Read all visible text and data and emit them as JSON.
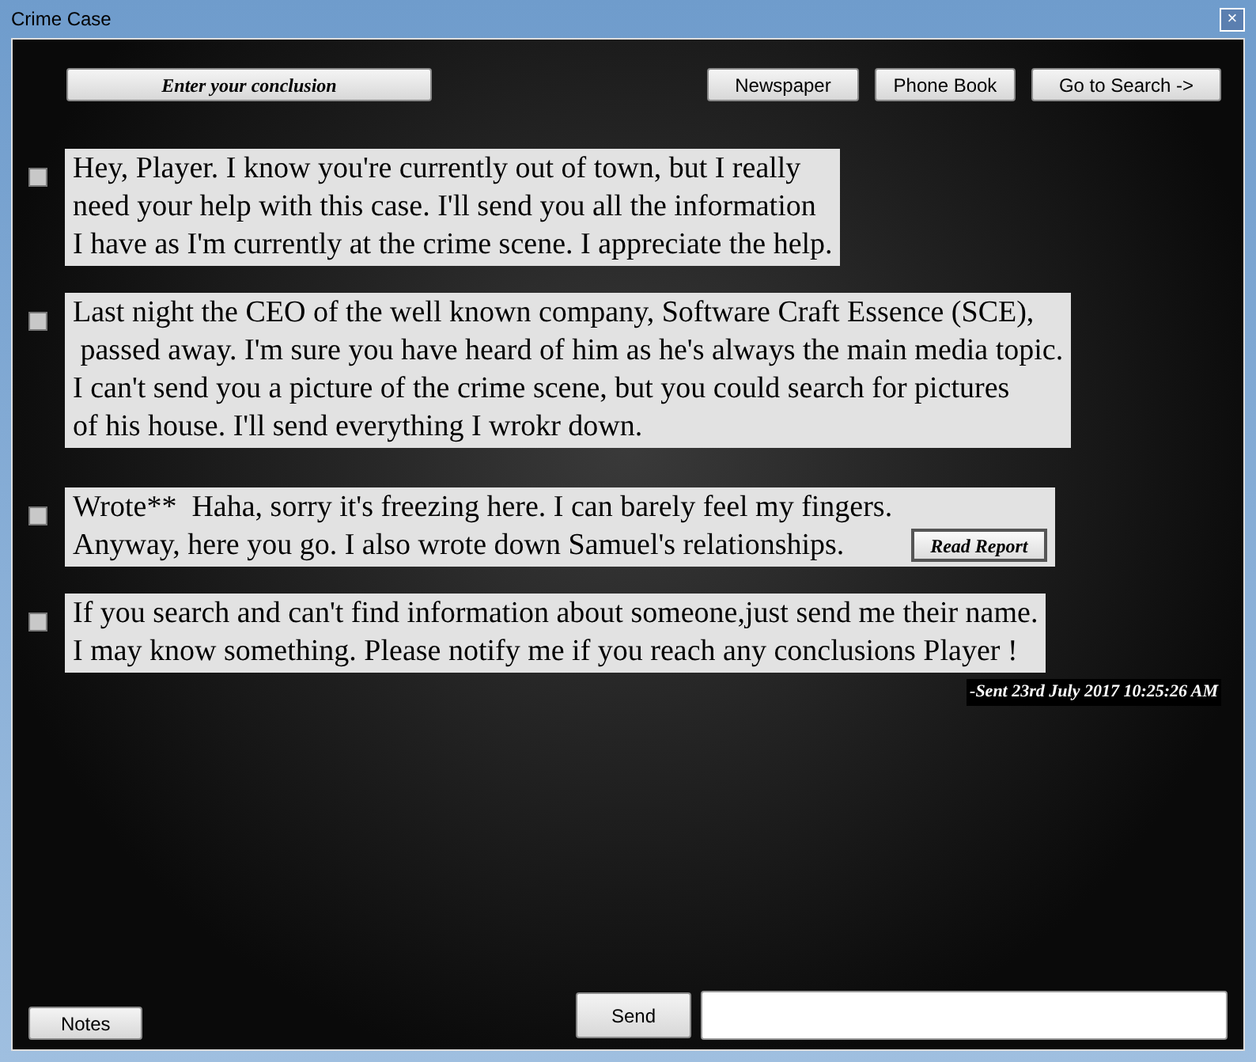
{
  "window": {
    "title": "Crime Case",
    "close": "×"
  },
  "top_buttons": {
    "conclusion": "Enter your conclusion",
    "actions": [
      "Newspaper",
      "Phone Book",
      "Go to Search ->"
    ]
  },
  "messages": [
    {
      "checked": false,
      "lines": [
        "Hey, Player. I know you're currently out of town, but I really",
        "need your help with this case. I'll send you all the information",
        "I have as I'm currently at the crime scene. I appreciate the help."
      ]
    },
    {
      "checked": false,
      "lines": [
        "Last night the CEO of the well known company, Software Craft Essence (SCE),",
        " passed away. I'm sure you have heard of him as he's always the main media topic.",
        "I can't send you a picture of the crime scene, but you could search for pictures",
        "of his house. I'll send everything I wrokr down."
      ]
    },
    {
      "checked": false,
      "lines": [
        "Wrote**  Haha, sorry it's freezing here. I can barely feel my fingers.",
        "Anyway, here you go. I also wrote down Samuel's relationships."
      ],
      "button": "Read Report"
    },
    {
      "checked": false,
      "lines": [
        "If you search and can't find information about someone,just send me their name.",
        "I may know something. Please notify me if you reach any conclusions Player !"
      ]
    }
  ],
  "sent": "-Sent 23rd July 2017 10:25:26 AM",
  "bottom": {
    "notes": "Notes",
    "send": "Send"
  }
}
